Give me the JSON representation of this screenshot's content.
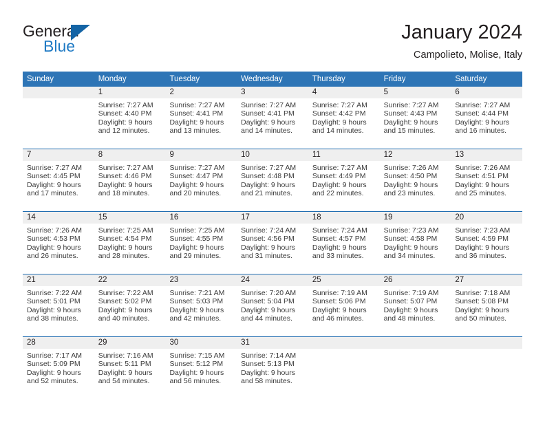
{
  "brand": {
    "name_part1": "General",
    "name_part2": "Blue",
    "logo_icon": "triangle-flag-icon",
    "accent_color": "#1f7ac4"
  },
  "header": {
    "title": "January 2024",
    "subtitle": "Campolieto, Molise, Italy"
  },
  "calendar": {
    "header_bg": "#2e75b6",
    "daynum_bg": "#efefef",
    "divider_color": "#1f6cb0",
    "weekdays": [
      "Sunday",
      "Monday",
      "Tuesday",
      "Wednesday",
      "Thursday",
      "Friday",
      "Saturday"
    ],
    "weeks": [
      [
        {
          "day": "",
          "lines": []
        },
        {
          "day": "1",
          "lines": [
            "Sunrise: 7:27 AM",
            "Sunset: 4:40 PM",
            "Daylight: 9 hours",
            "and 12 minutes."
          ]
        },
        {
          "day": "2",
          "lines": [
            "Sunrise: 7:27 AM",
            "Sunset: 4:41 PM",
            "Daylight: 9 hours",
            "and 13 minutes."
          ]
        },
        {
          "day": "3",
          "lines": [
            "Sunrise: 7:27 AM",
            "Sunset: 4:41 PM",
            "Daylight: 9 hours",
            "and 14 minutes."
          ]
        },
        {
          "day": "4",
          "lines": [
            "Sunrise: 7:27 AM",
            "Sunset: 4:42 PM",
            "Daylight: 9 hours",
            "and 14 minutes."
          ]
        },
        {
          "day": "5",
          "lines": [
            "Sunrise: 7:27 AM",
            "Sunset: 4:43 PM",
            "Daylight: 9 hours",
            "and 15 minutes."
          ]
        },
        {
          "day": "6",
          "lines": [
            "Sunrise: 7:27 AM",
            "Sunset: 4:44 PM",
            "Daylight: 9 hours",
            "and 16 minutes."
          ]
        }
      ],
      [
        {
          "day": "7",
          "lines": [
            "Sunrise: 7:27 AM",
            "Sunset: 4:45 PM",
            "Daylight: 9 hours",
            "and 17 minutes."
          ]
        },
        {
          "day": "8",
          "lines": [
            "Sunrise: 7:27 AM",
            "Sunset: 4:46 PM",
            "Daylight: 9 hours",
            "and 18 minutes."
          ]
        },
        {
          "day": "9",
          "lines": [
            "Sunrise: 7:27 AM",
            "Sunset: 4:47 PM",
            "Daylight: 9 hours",
            "and 20 minutes."
          ]
        },
        {
          "day": "10",
          "lines": [
            "Sunrise: 7:27 AM",
            "Sunset: 4:48 PM",
            "Daylight: 9 hours",
            "and 21 minutes."
          ]
        },
        {
          "day": "11",
          "lines": [
            "Sunrise: 7:27 AM",
            "Sunset: 4:49 PM",
            "Daylight: 9 hours",
            "and 22 minutes."
          ]
        },
        {
          "day": "12",
          "lines": [
            "Sunrise: 7:26 AM",
            "Sunset: 4:50 PM",
            "Daylight: 9 hours",
            "and 23 minutes."
          ]
        },
        {
          "day": "13",
          "lines": [
            "Sunrise: 7:26 AM",
            "Sunset: 4:51 PM",
            "Daylight: 9 hours",
            "and 25 minutes."
          ]
        }
      ],
      [
        {
          "day": "14",
          "lines": [
            "Sunrise: 7:26 AM",
            "Sunset: 4:53 PM",
            "Daylight: 9 hours",
            "and 26 minutes."
          ]
        },
        {
          "day": "15",
          "lines": [
            "Sunrise: 7:25 AM",
            "Sunset: 4:54 PM",
            "Daylight: 9 hours",
            "and 28 minutes."
          ]
        },
        {
          "day": "16",
          "lines": [
            "Sunrise: 7:25 AM",
            "Sunset: 4:55 PM",
            "Daylight: 9 hours",
            "and 29 minutes."
          ]
        },
        {
          "day": "17",
          "lines": [
            "Sunrise: 7:24 AM",
            "Sunset: 4:56 PM",
            "Daylight: 9 hours",
            "and 31 minutes."
          ]
        },
        {
          "day": "18",
          "lines": [
            "Sunrise: 7:24 AM",
            "Sunset: 4:57 PM",
            "Daylight: 9 hours",
            "and 33 minutes."
          ]
        },
        {
          "day": "19",
          "lines": [
            "Sunrise: 7:23 AM",
            "Sunset: 4:58 PM",
            "Daylight: 9 hours",
            "and 34 minutes."
          ]
        },
        {
          "day": "20",
          "lines": [
            "Sunrise: 7:23 AM",
            "Sunset: 4:59 PM",
            "Daylight: 9 hours",
            "and 36 minutes."
          ]
        }
      ],
      [
        {
          "day": "21",
          "lines": [
            "Sunrise: 7:22 AM",
            "Sunset: 5:01 PM",
            "Daylight: 9 hours",
            "and 38 minutes."
          ]
        },
        {
          "day": "22",
          "lines": [
            "Sunrise: 7:22 AM",
            "Sunset: 5:02 PM",
            "Daylight: 9 hours",
            "and 40 minutes."
          ]
        },
        {
          "day": "23",
          "lines": [
            "Sunrise: 7:21 AM",
            "Sunset: 5:03 PM",
            "Daylight: 9 hours",
            "and 42 minutes."
          ]
        },
        {
          "day": "24",
          "lines": [
            "Sunrise: 7:20 AM",
            "Sunset: 5:04 PM",
            "Daylight: 9 hours",
            "and 44 minutes."
          ]
        },
        {
          "day": "25",
          "lines": [
            "Sunrise: 7:19 AM",
            "Sunset: 5:06 PM",
            "Daylight: 9 hours",
            "and 46 minutes."
          ]
        },
        {
          "day": "26",
          "lines": [
            "Sunrise: 7:19 AM",
            "Sunset: 5:07 PM",
            "Daylight: 9 hours",
            "and 48 minutes."
          ]
        },
        {
          "day": "27",
          "lines": [
            "Sunrise: 7:18 AM",
            "Sunset: 5:08 PM",
            "Daylight: 9 hours",
            "and 50 minutes."
          ]
        }
      ],
      [
        {
          "day": "28",
          "lines": [
            "Sunrise: 7:17 AM",
            "Sunset: 5:09 PM",
            "Daylight: 9 hours",
            "and 52 minutes."
          ]
        },
        {
          "day": "29",
          "lines": [
            "Sunrise: 7:16 AM",
            "Sunset: 5:11 PM",
            "Daylight: 9 hours",
            "and 54 minutes."
          ]
        },
        {
          "day": "30",
          "lines": [
            "Sunrise: 7:15 AM",
            "Sunset: 5:12 PM",
            "Daylight: 9 hours",
            "and 56 minutes."
          ]
        },
        {
          "day": "31",
          "lines": [
            "Sunrise: 7:14 AM",
            "Sunset: 5:13 PM",
            "Daylight: 9 hours",
            "and 58 minutes."
          ]
        },
        {
          "day": "",
          "lines": []
        },
        {
          "day": "",
          "lines": []
        },
        {
          "day": "",
          "lines": []
        }
      ]
    ]
  }
}
